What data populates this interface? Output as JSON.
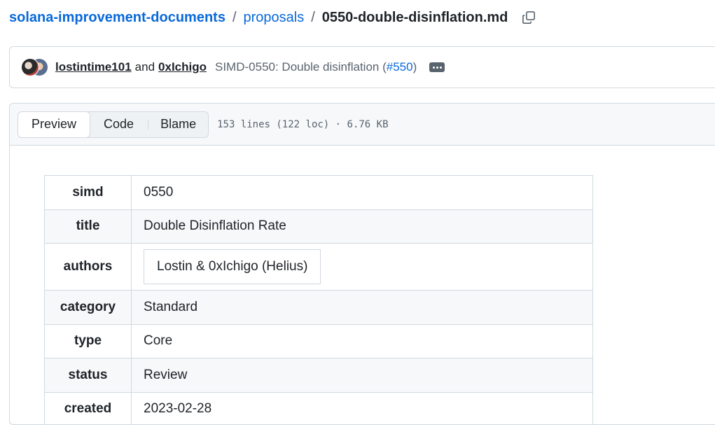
{
  "breadcrumb": {
    "repo": "solana-improvement-documents",
    "sep1": "/",
    "folder": "proposals",
    "sep2": "/",
    "file": "0550-double-disinflation.md",
    "copy_icon": "copy-icon"
  },
  "commit": {
    "author1": "lostintime101",
    "and": "and",
    "author2": "0xIchigo",
    "message": "SIMD-0550: Double disinflation (",
    "pr": "#550",
    "message_end": ")",
    "more_icon": "ellipsis-icon"
  },
  "file_header": {
    "tabs": [
      "Preview",
      "Code",
      "Blame"
    ],
    "active_tab": "Preview",
    "meta": "153 lines (122 loc) · 6.76 KB"
  },
  "frontmatter": {
    "rows": [
      {
        "key": "simd",
        "value": "0550"
      },
      {
        "key": "title",
        "value": "Double Disinflation Rate"
      },
      {
        "key": "authors",
        "value": "Lostin & 0xIchigo (Helius)"
      },
      {
        "key": "category",
        "value": "Standard"
      },
      {
        "key": "type",
        "value": "Core"
      },
      {
        "key": "status",
        "value": "Review"
      },
      {
        "key": "created",
        "value": "2023-02-28"
      }
    ]
  }
}
